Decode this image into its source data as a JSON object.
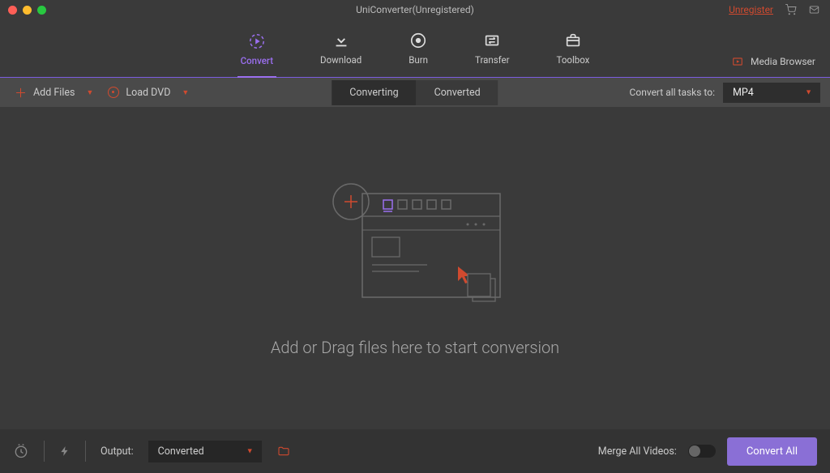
{
  "titlebar": {
    "title": "UniConverter(Unregistered)",
    "unregister": "Unregister"
  },
  "nav": {
    "items": [
      {
        "label": "Convert"
      },
      {
        "label": "Download"
      },
      {
        "label": "Burn"
      },
      {
        "label": "Transfer"
      },
      {
        "label": "Toolbox"
      }
    ],
    "media_browser": "Media Browser"
  },
  "toolbar": {
    "add_files": "Add Files",
    "load_dvd": "Load DVD",
    "tabs": {
      "converting": "Converting",
      "converted": "Converted"
    },
    "convert_all_label": "Convert all tasks to:",
    "format_selected": "MP4"
  },
  "canvas": {
    "placeholder": "Add or Drag files here to start conversion"
  },
  "bottombar": {
    "output_label": "Output:",
    "output_selected": "Converted",
    "merge_label": "Merge All Videos:",
    "convert_all_btn": "Convert All"
  }
}
